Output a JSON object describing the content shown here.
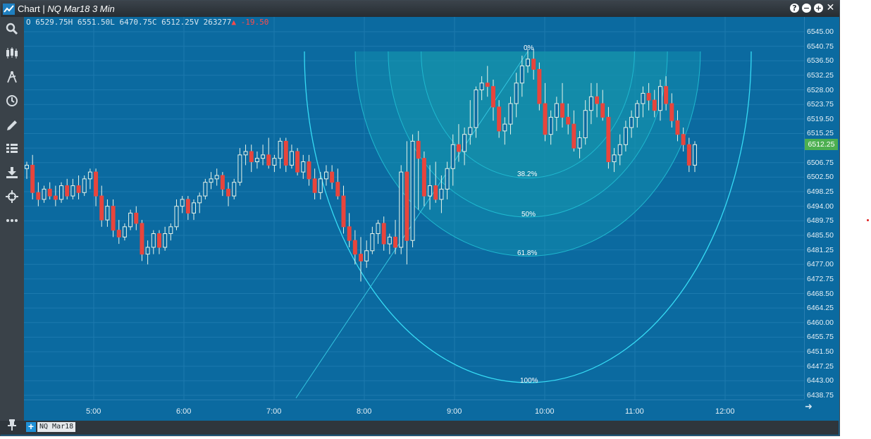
{
  "window": {
    "title": "Chart | ",
    "subtitle": "NQ Mar18 3 Min",
    "buttons": {
      "help": "?",
      "minimize": "−",
      "maximize": "+",
      "close": "✕"
    }
  },
  "ohlc": {
    "open": "O 6529.75",
    "high": "H 6551.50",
    "low": "L 6470.75",
    "close": "C 6512.25",
    "volume": "V 263277",
    "change": "▲ -19.50"
  },
  "toolbar": {
    "items": [
      "search-icon",
      "candles-icon",
      "drawing-tools-icon",
      "clock-icon",
      "pencil-icon",
      "studies-icon",
      "download-icon",
      "crosshair-icon",
      "more-icon"
    ]
  },
  "price_axis": {
    "labels": [
      "6545.00",
      "6540.75",
      "6536.50",
      "6532.25",
      "6528.00",
      "6523.75",
      "6519.50",
      "6515.25",
      "6511.00",
      "6506.75",
      "6502.50",
      "6498.25",
      "6494.00",
      "6489.75",
      "6485.50",
      "6481.25",
      "6477.00",
      "6472.75",
      "6468.50",
      "6464.25",
      "6460.00",
      "6455.75",
      "6451.50",
      "6447.25",
      "6443.00",
      "6438.75"
    ],
    "current_price": "6512.25",
    "current_price_color": "#4caf50"
  },
  "time_axis": {
    "labels": [
      "5:00",
      "6:00",
      "7:00",
      "8:00",
      "9:00",
      "10:00",
      "11:00",
      "12:00"
    ]
  },
  "fib_levels": [
    "0%",
    "38.2%",
    "50%",
    "61.8%",
    "100%"
  ],
  "bottom": {
    "add_label": "+",
    "symbol": "NQ Mar18"
  },
  "colors": {
    "background": "#0b6aa0",
    "up": "#e8f4e8",
    "down": "#e8453c",
    "arc": "#2fd5f0"
  },
  "chart_data": {
    "type": "candlestick",
    "ylim": [
      6436,
      6549
    ],
    "y_ticks": [
      6545.0,
      6540.75,
      6536.5,
      6532.25,
      6528.0,
      6523.75,
      6519.5,
      6515.25,
      6511.0,
      6506.75,
      6502.5,
      6498.25,
      6494.0,
      6489.75,
      6485.5,
      6481.25,
      6477.0,
      6472.75,
      6468.5,
      6464.25,
      6460.0,
      6455.75,
      6451.5,
      6447.25,
      6443.0,
      6438.75
    ],
    "x_ticks": [
      "5:00",
      "6:00",
      "7:00",
      "8:00",
      "9:00",
      "10:00",
      "11:00",
      "12:00"
    ],
    "candles": [
      [
        6505,
        6507,
        6502,
        6506
      ],
      [
        6506,
        6509,
        6496,
        6498
      ],
      [
        6498,
        6501,
        6494,
        6496
      ],
      [
        6496,
        6500,
        6495,
        6499
      ],
      [
        6499,
        6501,
        6496,
        6497
      ],
      [
        6497,
        6500,
        6494,
        6496
      ],
      [
        6496,
        6501,
        6495,
        6500
      ],
      [
        6500,
        6502,
        6496,
        6497
      ],
      [
        6497,
        6502,
        6496,
        6500
      ],
      [
        6500,
        6503,
        6496,
        6498
      ],
      [
        6498,
        6503,
        6497,
        6502
      ],
      [
        6502,
        6505,
        6499,
        6504
      ],
      [
        6504,
        6505,
        6494,
        6497
      ],
      [
        6497,
        6500,
        6488,
        6490
      ],
      [
        6490,
        6496,
        6488,
        6494
      ],
      [
        6494,
        6496,
        6485,
        6487
      ],
      [
        6487,
        6490,
        6483,
        6485
      ],
      [
        6485,
        6489,
        6484,
        6488
      ],
      [
        6488,
        6493,
        6487,
        6492
      ],
      [
        6492,
        6494,
        6487,
        6489
      ],
      [
        6489,
        6490,
        6478,
        6480
      ],
      [
        6480,
        6484,
        6477,
        6482
      ],
      [
        6482,
        6487,
        6480,
        6486
      ],
      [
        6486,
        6487,
        6480,
        6482
      ],
      [
        6482,
        6488,
        6481,
        6486
      ],
      [
        6486,
        6489,
        6484,
        6488
      ],
      [
        6488,
        6496,
        6487,
        6494
      ],
      [
        6494,
        6497,
        6492,
        6496
      ],
      [
        6496,
        6497,
        6490,
        6492
      ],
      [
        6492,
        6496,
        6490,
        6495
      ],
      [
        6495,
        6498,
        6492,
        6497
      ],
      [
        6497,
        6502,
        6496,
        6501
      ],
      [
        6501,
        6504,
        6499,
        6502
      ],
      [
        6502,
        6505,
        6500,
        6503
      ],
      [
        6503,
        6504,
        6497,
        6499
      ],
      [
        6499,
        6501,
        6494,
        6497
      ],
      [
        6497,
        6502,
        6496,
        6501
      ],
      [
        6501,
        6511,
        6500,
        6509
      ],
      [
        6509,
        6512,
        6506,
        6510
      ],
      [
        6510,
        6512,
        6504,
        6507
      ],
      [
        6507,
        6510,
        6505,
        6508
      ],
      [
        6508,
        6512,
        6506,
        6509
      ],
      [
        6509,
        6514,
        6505,
        6506
      ],
      [
        6506,
        6509,
        6504,
        6508
      ],
      [
        6508,
        6514,
        6505,
        6513
      ],
      [
        6513,
        6514,
        6504,
        6506
      ],
      [
        6506,
        6512,
        6505,
        6510
      ],
      [
        6510,
        6511,
        6503,
        6504
      ],
      [
        6504,
        6509,
        6502,
        6507
      ],
      [
        6507,
        6509,
        6500,
        6502
      ],
      [
        6502,
        6505,
        6496,
        6498
      ],
      [
        6498,
        6504,
        6496,
        6502
      ],
      [
        6502,
        6506,
        6500,
        6504
      ],
      [
        6504,
        6506,
        6499,
        6501
      ],
      [
        6501,
        6505,
        6496,
        6497
      ],
      [
        6497,
        6500,
        6486,
        6488
      ],
      [
        6488,
        6492,
        6482,
        6484
      ],
      [
        6484,
        6487,
        6477,
        6480
      ],
      [
        6480,
        6485,
        6472,
        6478
      ],
      [
        6478,
        6484,
        6476,
        6481
      ],
      [
        6481,
        6488,
        6480,
        6486
      ],
      [
        6486,
        6490,
        6483,
        6489
      ],
      [
        6489,
        6491,
        6481,
        6483
      ],
      [
        6483,
        6486,
        6480,
        6485
      ],
      [
        6485,
        6490,
        6480,
        6482
      ],
      [
        6482,
        6506,
        6480,
        6504
      ],
      [
        6504,
        6513,
        6477,
        6484
      ],
      [
        6484,
        6515,
        6482,
        6513
      ],
      [
        6513,
        6516,
        6493,
        6508
      ],
      [
        6508,
        6510,
        6494,
        6497
      ],
      [
        6497,
        6506,
        6493,
        6500
      ],
      [
        6500,
        6507,
        6495,
        6496
      ],
      [
        6496,
        6503,
        6492,
        6499
      ],
      [
        6499,
        6507,
        6496,
        6505
      ],
      [
        6505,
        6515,
        6500,
        6512
      ],
      [
        6512,
        6518,
        6507,
        6510
      ],
      [
        6510,
        6517,
        6506,
        6515
      ],
      [
        6515,
        6525,
        6512,
        6517
      ],
      [
        6517,
        6529,
        6514,
        6528
      ],
      [
        6528,
        6532,
        6525,
        6530
      ],
      [
        6530,
        6535,
        6526,
        6529
      ],
      [
        6529,
        6531,
        6519,
        6523
      ],
      [
        6523,
        6525,
        6514,
        6516
      ],
      [
        6516,
        6520,
        6512,
        6518
      ],
      [
        6518,
        6526,
        6515,
        6524
      ],
      [
        6524,
        6533,
        6520,
        6530
      ],
      [
        6530,
        6538,
        6526,
        6535
      ],
      [
        6535,
        6540,
        6533,
        6537
      ],
      [
        6537,
        6540,
        6531,
        6534
      ],
      [
        6534,
        6536,
        6522,
        6524
      ],
      [
        6524,
        6530,
        6513,
        6515
      ],
      [
        6515,
        6522,
        6512,
        6520
      ],
      [
        6520,
        6526,
        6516,
        6524
      ],
      [
        6524,
        6530,
        6517,
        6520
      ],
      [
        6520,
        6524,
        6515,
        6518
      ],
      [
        6518,
        6522,
        6510,
        6511
      ],
      [
        6511,
        6516,
        6508,
        6514
      ],
      [
        6514,
        6525,
        6512,
        6522
      ],
      [
        6522,
        6530,
        6518,
        6526
      ],
      [
        6526,
        6530,
        6520,
        6524
      ],
      [
        6524,
        6528,
        6519,
        6520
      ],
      [
        6520,
        6523,
        6505,
        6507
      ],
      [
        6507,
        6511,
        6504,
        6509
      ],
      [
        6509,
        6515,
        6506,
        6512
      ],
      [
        6512,
        6519,
        6510,
        6517
      ],
      [
        6517,
        6522,
        6514,
        6520
      ],
      [
        6520,
        6525,
        6517,
        6524
      ],
      [
        6524,
        6529,
        6520,
        6527
      ],
      [
        6527,
        6530,
        6522,
        6525
      ],
      [
        6525,
        6528,
        6520,
        6522
      ],
      [
        6522,
        6531,
        6519,
        6529
      ],
      [
        6529,
        6532,
        6522,
        6524
      ],
      [
        6524,
        6527,
        6517,
        6519
      ],
      [
        6519,
        6522,
        6513,
        6515
      ],
      [
        6515,
        6517,
        6510,
        6512
      ],
      [
        6512,
        6514,
        6504,
        6506
      ],
      [
        6506,
        6513,
        6504,
        6512
      ]
    ]
  }
}
